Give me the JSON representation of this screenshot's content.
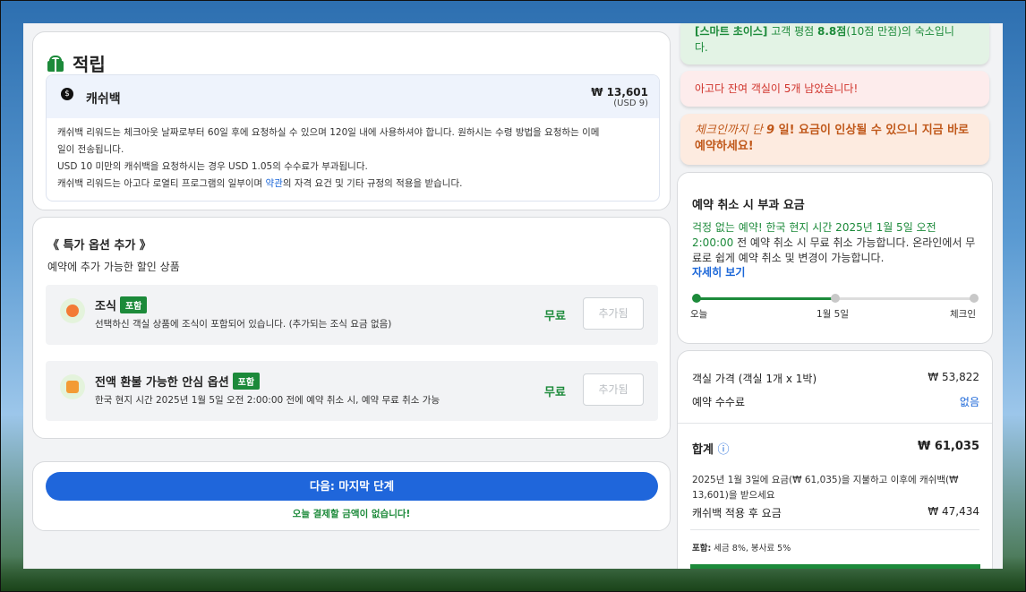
{
  "reward": {
    "title": "적립",
    "cashback_label": "캐쉬백",
    "amount_krw": "₩ 13,601",
    "amount_usd": "(USD 9)",
    "line1": "캐쉬백 리워드는 체크아웃 날짜로부터 60일 후에 요청하실 수 있으며 120일 내에 사용하셔야 합니다. 원하시는 수령 방법을 요청하는 이메",
    "line2": "일이 전송됩니다.",
    "line3": "USD 10 미만의 캐쉬백을 요청하시는 경우 USD 1.05의 수수료가 부과됩니다.",
    "line4_pre": "캐쉬백 리워드는 아고다 로열티 프로그램의 일부이며 ",
    "line4_link": "약관",
    "line4_post": "의 자격 요건 및 기타 규정의 적용을 받습니다."
  },
  "special": {
    "title": "《 특가 옵션 추가 》",
    "subtitle": "예약에 추가 가능한 할인 상품",
    "options": [
      {
        "name": "조식",
        "badge": "포함",
        "desc": "선택하신 객실 상품에 조식이 포함되어 있습니다. (추가되는 조식 요금 없음)",
        "price": "무료",
        "button": "추가됨"
      },
      {
        "name": "전액 환불 가능한 안심 옵션",
        "badge": "포함",
        "desc": "한국 현지 시간 2025년 1월 5일 오전 2:00:00 전에 예약 취소 시, 예약 무료 취소 가능",
        "price": "무료",
        "button": "추가됨"
      }
    ]
  },
  "next": {
    "button": "다음: 마지막 단계",
    "note": "오늘 결제할 금액이 없습니다!"
  },
  "notes": {
    "green_bracket": "[스마트 초이스]",
    "green_mid": " 고객 평점 ",
    "green_score": "8.8점",
    "green_tail": "(10점 만점)의 숙소입니",
    "green_tail2": "다.",
    "red": "아고다 잔여 객실이 5개 남았습니다!",
    "orange_italic": "체크인까지 단 ",
    "orange_days": "9",
    "orange_rest": " 일! 요금이 인상될 수 있으니 지금 바로",
    "orange_line2": "예약하세요!"
  },
  "cancel": {
    "title": "예약 취소 시 부과 요금",
    "text_green1": "걱정 없는 예약! 한국 현지 시간 2025년 1월 5일 오전",
    "text_green2": "2:00:00",
    "text_rest": " 전 예약 취소 시 무료 취소 가능합니다. 온라인에서 무료로 쉽게 예약 취소 및 변경이 가능합니다.",
    "more": "자세히 보기",
    "timeline": [
      "오늘",
      "1월 5일",
      "체크인"
    ]
  },
  "price": {
    "room_label": "객실 가격 (객실 1개 x 1박)",
    "room_value": "₩ 53,822",
    "fee_label": "예약 수수료",
    "fee_value": "없음",
    "total_label": "합계",
    "info_icon": "ⓘ",
    "total_value": "₩ 61,035",
    "small_text": "2025년 1월 3일에 요금(₩ 61,035)을 지불하고 이후에 캐쉬백(₩ 13,601)을 받으세요",
    "after_label": "캐쉬백 적용 후 요금",
    "after_value": "₩ 47,434",
    "tax_bold": "포함:",
    "tax_text": " 세금 8%, 봉사료 5%"
  },
  "colors": {
    "green": "#1c8a3a",
    "blue": "#1f66db",
    "red": "#d0342c",
    "orange": "#c0581a"
  }
}
